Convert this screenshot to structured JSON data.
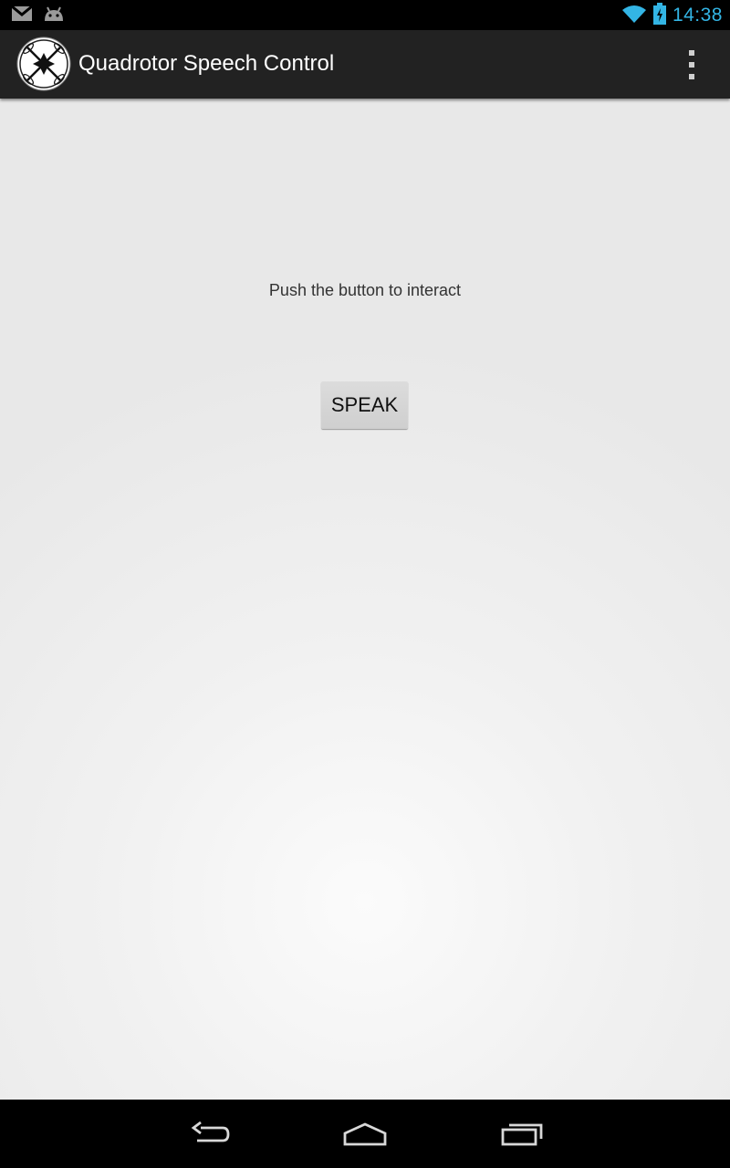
{
  "status_bar": {
    "time": "14:38",
    "icons": [
      "gmail-icon",
      "android-icon",
      "wifi-icon",
      "battery-charging-icon"
    ],
    "time_color": "#33b5e5"
  },
  "action_bar": {
    "title": "Quadrotor Speech Control",
    "logo_icon": "quadrotor-logo-icon",
    "menu_icon": "overflow-menu-icon",
    "background": "#222222"
  },
  "main": {
    "prompt": "Push the button to interact",
    "speak_button_label": "SPEAK"
  },
  "nav_bar": {
    "buttons": [
      "back-icon",
      "home-icon",
      "recent-apps-icon"
    ]
  }
}
